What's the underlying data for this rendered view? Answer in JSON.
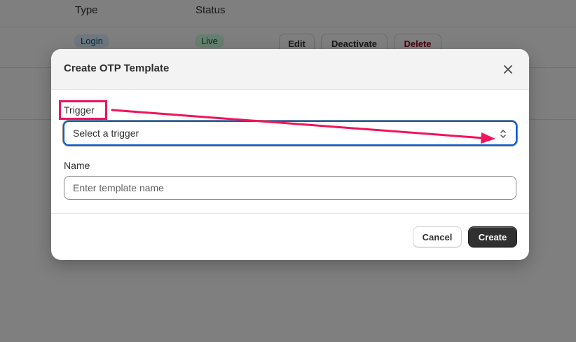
{
  "background_table": {
    "headers": {
      "type": "Type",
      "status": "Status"
    },
    "row": {
      "type_badge": "Login",
      "status_badge": "Live",
      "actions": {
        "edit": "Edit",
        "deactivate": "Deactivate",
        "delete": "Delete"
      }
    }
  },
  "modal": {
    "title": "Create OTP Template",
    "trigger_label": "Trigger",
    "trigger_value": "Select a trigger",
    "name_label": "Name",
    "name_placeholder": "Enter template name",
    "name_value": "",
    "cancel_label": "Cancel",
    "create_label": "Create"
  },
  "icons": {
    "close": "close-icon",
    "select_chevron": "chevron-up-down-icon"
  },
  "colors": {
    "annotation": "#f0145a",
    "primary_button": "#303030",
    "focus_border": "#005bd3",
    "overlay": "rgba(0,0,0,0.5)"
  }
}
